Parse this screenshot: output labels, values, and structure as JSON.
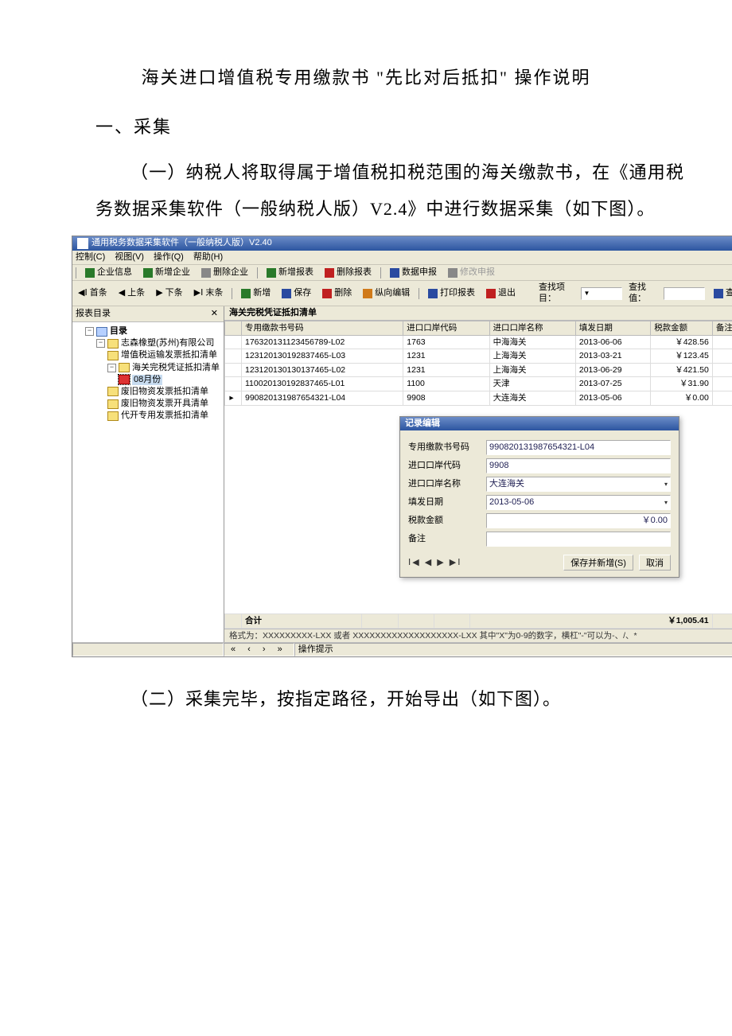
{
  "doc": {
    "title": "海关进口增值税专用缴款书 \"先比对后抵扣\" 操作说明",
    "section1": "一、采集",
    "para1": "（一）纳税人将取得属于增值税扣税范围的海关缴款书，在《通用税务数据采集软件（一般纳税人版）V2.4》中进行数据采集（如下图）。",
    "para2": "（二）采集完毕，按指定路径，开始导出（如下图）。"
  },
  "window": {
    "title": "通用税务数据采集软件（一般纳税人版）V2.40"
  },
  "menu": {
    "control": "控制(C)",
    "view": "视图(V)",
    "operate": "操作(Q)",
    "help": "帮助(H)"
  },
  "tb1": {
    "ent_info": "企业信息",
    "add_ent": "新增企业",
    "del_ent": "删除企业",
    "new_report": "新增报表",
    "del_report": "删除报表",
    "data_declare": "数据申报",
    "mod_declare": "修改申报"
  },
  "tb2": {
    "first": "首条",
    "prev": "上条",
    "next": "下条",
    "last": "末条",
    "add": "新增",
    "save": "保存",
    "del": "删除",
    "batch": "纵向编辑",
    "print": "打印报表",
    "exit": "退出",
    "find_label": "查找项目：",
    "find_val": "查找值：",
    "find_btn": "查找"
  },
  "tree": {
    "header": "报表目录",
    "root": "目录",
    "company": "志森橡塑(苏州)有限公司",
    "items": [
      "增值税运输发票抵扣清单",
      "海关完税凭证抵扣清单",
      "08月份",
      "废旧物资发票抵扣清单",
      "废旧物资发票开具清单",
      "代开专用发票抵扣清单"
    ]
  },
  "tab": {
    "title": "海关完税凭证抵扣清单"
  },
  "cols": {
    "c0": "",
    "c1": "专用缴款书号码",
    "c2": "进口口岸代码",
    "c3": "进口口岸名称",
    "c4": "填发日期",
    "c5": "税款金额",
    "c6": "备注"
  },
  "rows": [
    {
      "mark": "",
      "num": "176320131123456789-L02",
      "code": "1763",
      "name": "中海海关",
      "date": "2013-06-06",
      "amt": "￥428.56",
      "remark": ""
    },
    {
      "mark": "",
      "num": "123120130192837465-L03",
      "code": "1231",
      "name": "上海海关",
      "date": "2013-03-21",
      "amt": "￥123.45",
      "remark": ""
    },
    {
      "mark": "",
      "num": "123120130130137465-L02",
      "code": "1231",
      "name": "上海海关",
      "date": "2013-06-29",
      "amt": "￥421.50",
      "remark": ""
    },
    {
      "mark": "",
      "num": "110020130192837465-L01",
      "code": "1100",
      "name": "天津",
      "date": "2013-07-25",
      "amt": "￥31.90",
      "remark": ""
    },
    {
      "mark": "▸",
      "num": "990820131987654321-L04",
      "code": "9908",
      "name": "大连海关",
      "date": "2013-05-06",
      "amt": "￥0.00",
      "remark": ""
    }
  ],
  "sum": {
    "label": "合计",
    "amt": "￥1,005.41"
  },
  "hint": "格式为：XXXXXXXXX-LXX 或者 XXXXXXXXXXXXXXXXXXX-LXX   其中\"X\"为0-9的数字，横杠\"-\"可以为-、/、*",
  "dialog": {
    "title": "记录编辑",
    "f_num_label": "专用缴款书号码",
    "f_num_value": "990820131987654321-L04",
    "f_code_label": "进口口岸代码",
    "f_code_value": "9908",
    "f_name_label": "进口口岸名称",
    "f_name_value": "大连海关",
    "f_date_label": "填发日期",
    "f_date_value": "2013-05-06",
    "f_amt_label": "税款金额",
    "f_amt_value": "￥0.00",
    "f_remark_label": "备注",
    "nav": "Ⅰ◀ ◀ ▶ ▶Ⅰ",
    "btn_save": "保存并新增(S)",
    "btn_cancel": "取消"
  },
  "status": {
    "hint": "操作提示"
  }
}
